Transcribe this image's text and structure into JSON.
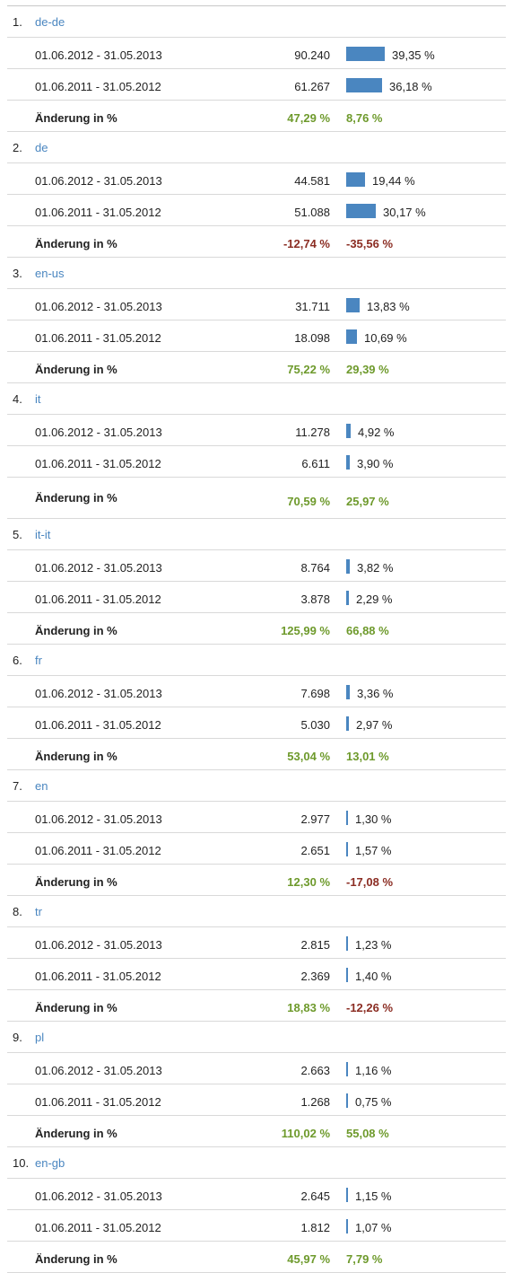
{
  "labels": {
    "change_label": "Änderung in %"
  },
  "colors": {
    "bar": "#4a86c0",
    "link": "#4a86c0",
    "positive": "#6e9a2c",
    "negative": "#8b2d23"
  },
  "groups": [
    {
      "rank": "1.",
      "lang": "de-de",
      "periods": [
        {
          "range": "01.06.2012 - 31.05.2013",
          "value": "90.240",
          "pct": "39,35 %",
          "share": 39.35
        },
        {
          "range": "01.06.2011 - 31.05.2012",
          "value": "61.267",
          "pct": "36,18 %",
          "share": 36.18
        }
      ],
      "change1": "47,29 %",
      "change1_sign": "pos",
      "change2": "8,76 %",
      "change2_sign": "pos"
    },
    {
      "rank": "2.",
      "lang": "de",
      "periods": [
        {
          "range": "01.06.2012 - 31.05.2013",
          "value": "44.581",
          "pct": "19,44 %",
          "share": 19.44
        },
        {
          "range": "01.06.2011 - 31.05.2012",
          "value": "51.088",
          "pct": "30,17 %",
          "share": 30.17
        }
      ],
      "change1": "-12,74 %",
      "change1_sign": "neg",
      "change2": "-35,56 %",
      "change2_sign": "neg"
    },
    {
      "rank": "3.",
      "lang": "en-us",
      "periods": [
        {
          "range": "01.06.2012 - 31.05.2013",
          "value": "31.711",
          "pct": "13,83 %",
          "share": 13.83
        },
        {
          "range": "01.06.2011 - 31.05.2012",
          "value": "18.098",
          "pct": "10,69 %",
          "share": 10.69
        }
      ],
      "change1": "75,22 %",
      "change1_sign": "pos",
      "change2": "29,39 %",
      "change2_sign": "pos"
    },
    {
      "rank": "4.",
      "lang": "it",
      "periods": [
        {
          "range": "01.06.2012 - 31.05.2013",
          "value": "11.278",
          "pct": "4,92 %",
          "share": 4.92
        },
        {
          "range": "01.06.2011 - 31.05.2012",
          "value": "6.611",
          "pct": "3,90 %",
          "share": 3.9
        }
      ],
      "change1": "70,59 %",
      "change1_sign": "pos",
      "change2": "25,97 %",
      "change2_sign": "pos",
      "tall": true
    },
    {
      "rank": "5.",
      "lang": "it-it",
      "periods": [
        {
          "range": "01.06.2012 - 31.05.2013",
          "value": "8.764",
          "pct": "3,82 %",
          "share": 3.82
        },
        {
          "range": "01.06.2011 - 31.05.2012",
          "value": "3.878",
          "pct": "2,29 %",
          "share": 2.29
        }
      ],
      "change1": "125,99 %",
      "change1_sign": "pos",
      "change2": "66,88 %",
      "change2_sign": "pos"
    },
    {
      "rank": "6.",
      "lang": "fr",
      "periods": [
        {
          "range": "01.06.2012 - 31.05.2013",
          "value": "7.698",
          "pct": "3,36 %",
          "share": 3.36
        },
        {
          "range": "01.06.2011 - 31.05.2012",
          "value": "5.030",
          "pct": "2,97 %",
          "share": 2.97
        }
      ],
      "change1": "53,04 %",
      "change1_sign": "pos",
      "change2": "13,01 %",
      "change2_sign": "pos"
    },
    {
      "rank": "7.",
      "lang": "en",
      "periods": [
        {
          "range": "01.06.2012 - 31.05.2013",
          "value": "2.977",
          "pct": "1,30 %",
          "share": 1.3
        },
        {
          "range": "01.06.2011 - 31.05.2012",
          "value": "2.651",
          "pct": "1,57 %",
          "share": 1.57
        }
      ],
      "change1": "12,30 %",
      "change1_sign": "pos",
      "change2": "-17,08 %",
      "change2_sign": "neg"
    },
    {
      "rank": "8.",
      "lang": "tr",
      "periods": [
        {
          "range": "01.06.2012 - 31.05.2013",
          "value": "2.815",
          "pct": "1,23 %",
          "share": 1.23
        },
        {
          "range": "01.06.2011 - 31.05.2012",
          "value": "2.369",
          "pct": "1,40 %",
          "share": 1.4
        }
      ],
      "change1": "18,83 %",
      "change1_sign": "pos",
      "change2": "-12,26 %",
      "change2_sign": "neg"
    },
    {
      "rank": "9.",
      "lang": "pl",
      "periods": [
        {
          "range": "01.06.2012 - 31.05.2013",
          "value": "2.663",
          "pct": "1,16 %",
          "share": 1.16
        },
        {
          "range": "01.06.2011 - 31.05.2012",
          "value": "1.268",
          "pct": "0,75 %",
          "share": 0.75
        }
      ],
      "change1": "110,02 %",
      "change1_sign": "pos",
      "change2": "55,08 %",
      "change2_sign": "pos"
    },
    {
      "rank": "10.",
      "lang": "en-gb",
      "periods": [
        {
          "range": "01.06.2012 - 31.05.2013",
          "value": "2.645",
          "pct": "1,15 %",
          "share": 1.15
        },
        {
          "range": "01.06.2011 - 31.05.2012",
          "value": "1.812",
          "pct": "1,07 %",
          "share": 1.07
        }
      ],
      "change1": "45,97 %",
      "change1_sign": "pos",
      "change2": "7,79 %",
      "change2_sign": "pos"
    }
  ]
}
